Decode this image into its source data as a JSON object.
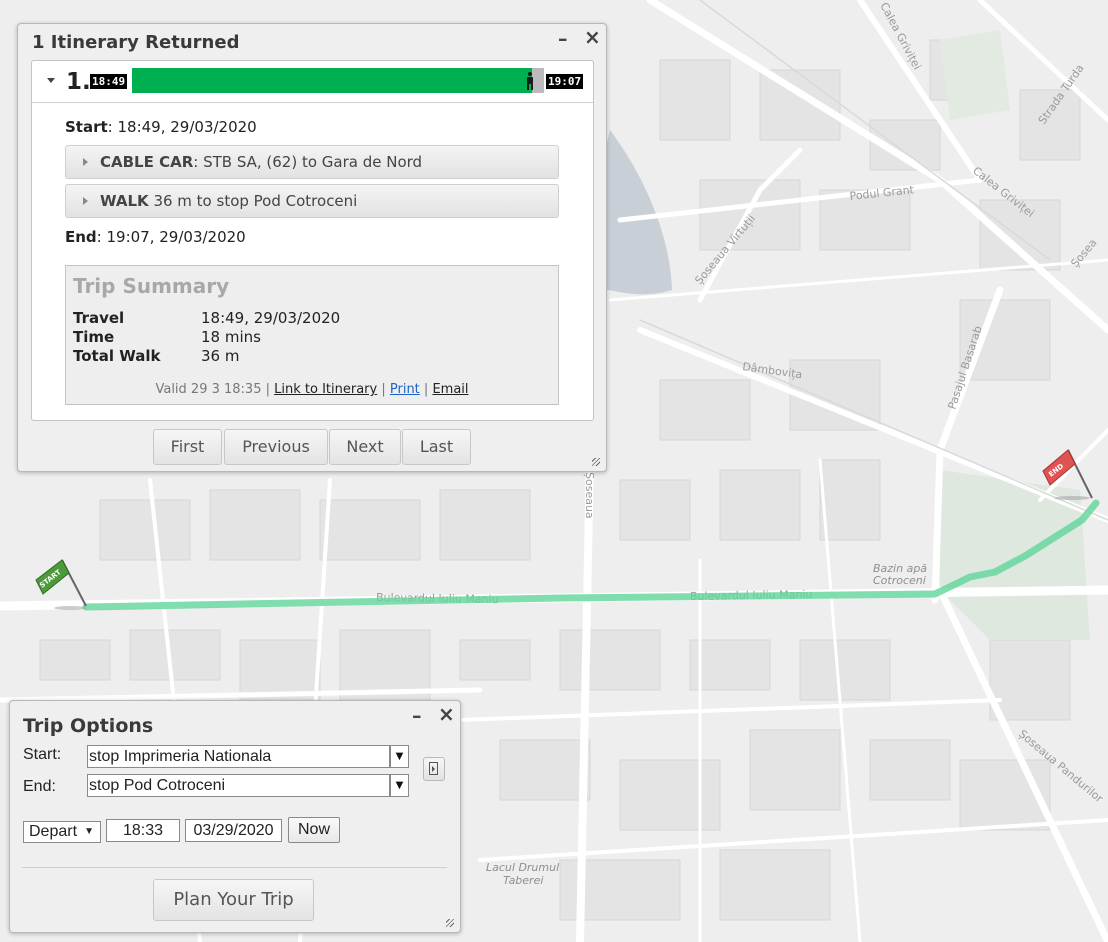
{
  "map": {
    "labels": {
      "calea_grivitei_1": "Calea Griviței",
      "calea_grivitei_2": "Calea Griviței",
      "strada_turda": "Strada Turda",
      "podul_grant": "Podul Grant",
      "soseaua_virtutii": "Șoseaua Virtuții",
      "dambovita": "Dâmbovița",
      "pasajul_basarab": "Pasajul Basarab",
      "soseaua_v": "Șoseaua",
      "soseaua_right": "Șosea",
      "bulevardul_1": "Bulevardul Iuliu Maniu",
      "bulevardul_2": "Bulevardul Iuliu Maniu",
      "bazin_1": "Bazin apă",
      "bazin_2": "Cotroceni",
      "soseaua_pandurilor": "Șoseaua Pandurilor",
      "lacul_1": "Lacul Drumul",
      "lacul_2": "Taberei"
    },
    "start_flag": "START",
    "end_flag": "END",
    "route_color": "#5fd49a"
  },
  "itinerary": {
    "title": "1 Itinerary Returned",
    "minimize": "–",
    "close": "×",
    "number": "1.",
    "bar_start": "18:49",
    "bar_end": "19:07",
    "bar_color": "#00b050",
    "walk_fraction": 0.03,
    "start_label": "Start",
    "start_value": ": 18:49, 29/03/2020",
    "legs": [
      {
        "mode": "CABLE CAR",
        "desc": ": STB SA, (62) to Gara de Nord"
      },
      {
        "mode": "WALK",
        "desc": " 36 m to stop Pod Cotroceni"
      }
    ],
    "end_label": "End",
    "end_value": ": 19:07, 29/03/2020",
    "summary": {
      "title": "Trip Summary",
      "rows": [
        {
          "label": "Travel",
          "value": "18:49, 29/03/2020"
        },
        {
          "label": "Time",
          "value": "18 mins"
        },
        {
          "label": "Total Walk",
          "value": "36 m"
        }
      ],
      "valid": "Valid 29 3 18:35 |",
      "link_itinerary": "Link to Itinerary",
      "sep1": "|",
      "print": "Print",
      "sep2": "|",
      "email": "Email"
    },
    "nav": {
      "first": "First",
      "previous": "Previous",
      "next": "Next",
      "last": "Last"
    }
  },
  "trip_options": {
    "title": "Trip Options",
    "minimize": "–",
    "close": "×",
    "start_label": "Start:",
    "start_value": "stop Imprimeria Nationala",
    "end_label": "End:",
    "end_value": "stop Pod Cotroceni",
    "depart": "Depart",
    "time": "18:33",
    "date": "03/29/2020",
    "now": "Now",
    "plan": "Plan Your Trip"
  }
}
